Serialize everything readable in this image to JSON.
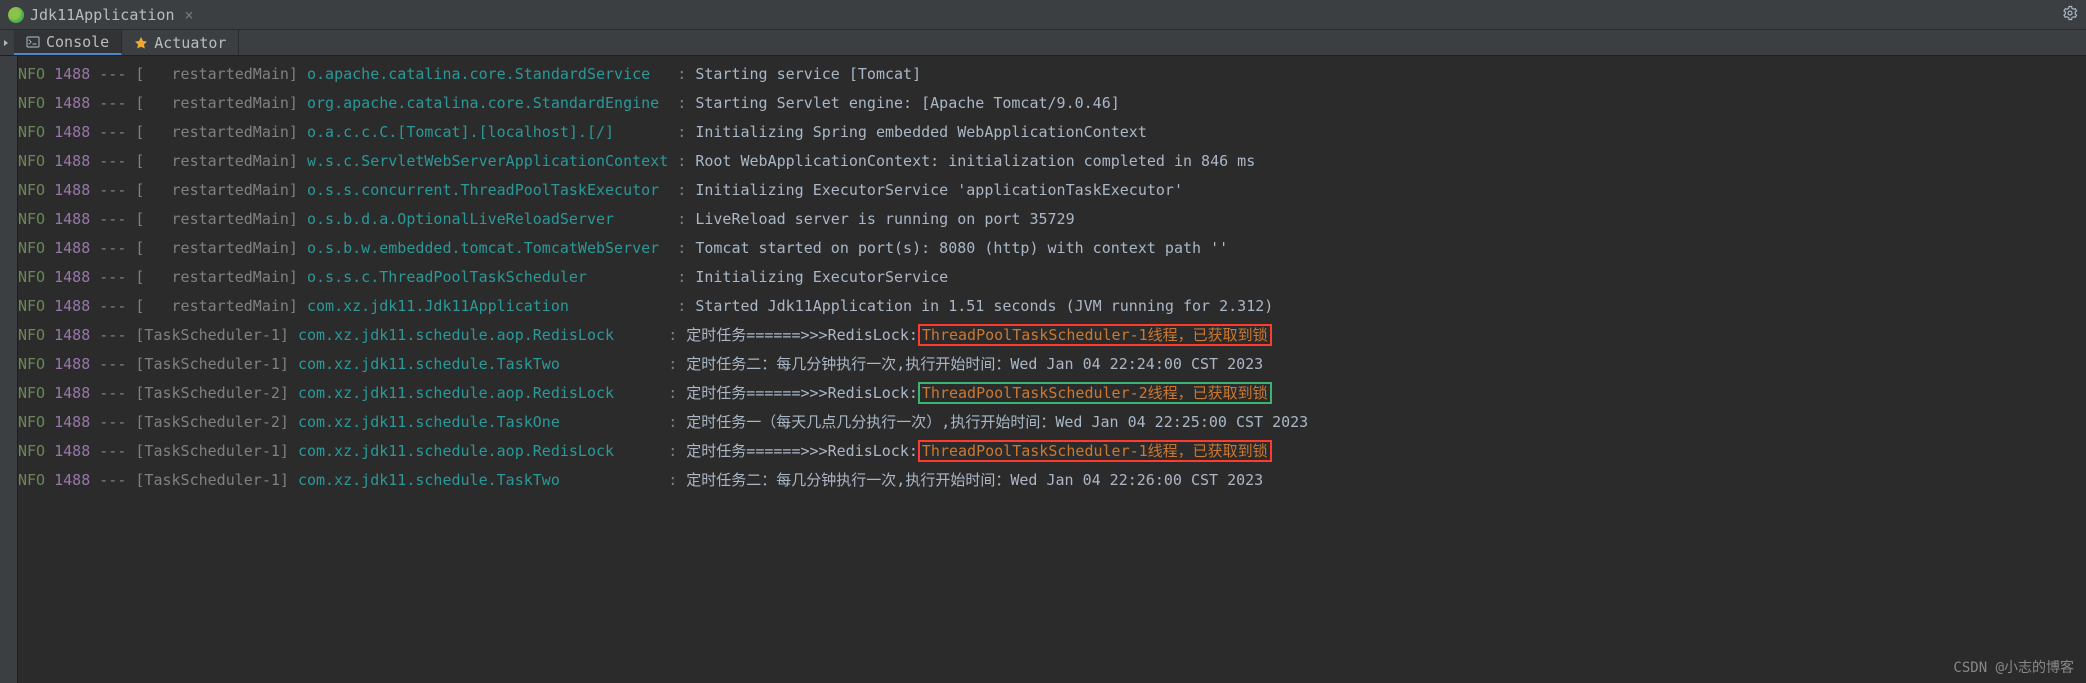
{
  "title": {
    "app_name": "Jdk11Application",
    "close": "×"
  },
  "tabs": {
    "console": "Console",
    "actuator": "Actuator"
  },
  "watermark": "CSDN @小志的博客",
  "log": {
    "level": "NFO",
    "pid": "1488",
    "sep": "---",
    "lines": [
      {
        "thread": "[   restartedMain]",
        "logger": "o.apache.catalina.core.StandardService  ",
        "msg_plain": "Starting service [Tomcat]"
      },
      {
        "thread": "[   restartedMain]",
        "logger": "org.apache.catalina.core.StandardEngine ",
        "msg_plain": "Starting Servlet engine: [Apache Tomcat/9.0.46]"
      },
      {
        "thread": "[   restartedMain]",
        "logger": "o.a.c.c.C.[Tomcat].[localhost].[/]      ",
        "msg_plain": "Initializing Spring embedded WebApplicationContext"
      },
      {
        "thread": "[   restartedMain]",
        "logger": "w.s.c.ServletWebServerApplicationContext",
        "msg_plain": "Root WebApplicationContext: initialization completed in 846 ms"
      },
      {
        "thread": "[   restartedMain]",
        "logger": "o.s.s.concurrent.ThreadPoolTaskExecutor ",
        "msg_plain": "Initializing ExecutorService 'applicationTaskExecutor'"
      },
      {
        "thread": "[   restartedMain]",
        "logger": "o.s.b.d.a.OptionalLiveReloadServer      ",
        "msg_plain": "LiveReload server is running on port 35729"
      },
      {
        "thread": "[   restartedMain]",
        "logger": "o.s.b.w.embedded.tomcat.TomcatWebServer ",
        "msg_plain": "Tomcat started on port(s): 8080 (http) with context path ''"
      },
      {
        "thread": "[   restartedMain]",
        "logger": "o.s.s.c.ThreadPoolTaskScheduler         ",
        "msg_plain": "Initializing ExecutorService"
      },
      {
        "thread": "[   restartedMain]",
        "logger": "com.xz.jdk11.Jdk11Application           ",
        "msg_plain": "Started Jdk11Application in 1.51 seconds (JVM running for 2.312)"
      },
      {
        "thread": "[TaskScheduler-1]",
        "logger": "com.xz.jdk11.schedule.aop.RedisLock     ",
        "msg_pre": "定时任务======>>>RedisLock:",
        "msg_hl": "ThreadPoolTaskScheduler-1线程，已获取到锁",
        "hl_class": "hl-red"
      },
      {
        "thread": "[TaskScheduler-1]",
        "logger": "com.xz.jdk11.schedule.TaskTwo           ",
        "msg_plain": "定时任务二：每几分钟执行一次,执行开始时间：Wed Jan 04 22:24:00 CST 2023"
      },
      {
        "thread": "[TaskScheduler-2]",
        "logger": "com.xz.jdk11.schedule.aop.RedisLock     ",
        "msg_pre": "定时任务======>>>RedisLock:",
        "msg_hl": "ThreadPoolTaskScheduler-2线程，已获取到锁",
        "hl_class": "hl-green"
      },
      {
        "thread": "[TaskScheduler-2]",
        "logger": "com.xz.jdk11.schedule.TaskOne           ",
        "msg_plain": "定时任务一（每天几点几分执行一次）,执行开始时间：Wed Jan 04 22:25:00 CST 2023"
      },
      {
        "thread": "[TaskScheduler-1]",
        "logger": "com.xz.jdk11.schedule.aop.RedisLock     ",
        "msg_pre": "定时任务======>>>RedisLock:",
        "msg_hl": "ThreadPoolTaskScheduler-1线程，已获取到锁",
        "hl_class": "hl-red"
      },
      {
        "thread": "[TaskScheduler-1]",
        "logger": "com.xz.jdk11.schedule.TaskTwo           ",
        "msg_plain": "定时任务二：每几分钟执行一次,执行开始时间：Wed Jan 04 22:26:00 CST 2023"
      }
    ]
  }
}
